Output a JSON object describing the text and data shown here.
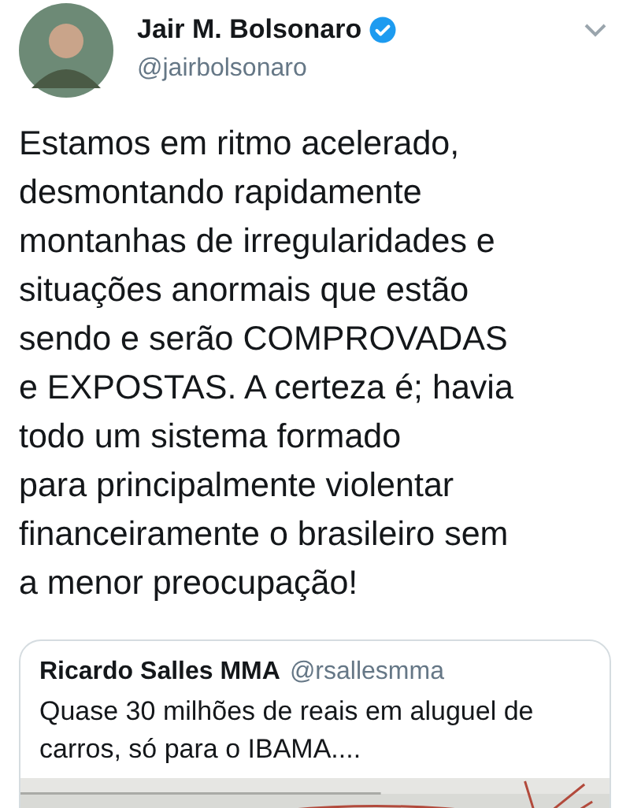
{
  "author": {
    "name": "Jair M. Bolsonaro",
    "verified": true,
    "handle": "@jairbolsonaro"
  },
  "text": "Estamos em ritmo acelerado,\ndesmontando rapidamente\nmontanhas de irregularidades e\nsituações anormais que estão\nsendo e serão COMPROVADAS\ne EXPOSTAS. A certeza é; havia\ntodo um sistema formado\npara principalmente violentar\nfinanceiramente o brasileiro sem\na menor preocupação!",
  "quoted": {
    "name": "Ricardo Salles MMA",
    "handle": "@rsallesmma",
    "text": "Quase 30 milhões de reais em aluguel de carros, só para o IBAMA...."
  }
}
